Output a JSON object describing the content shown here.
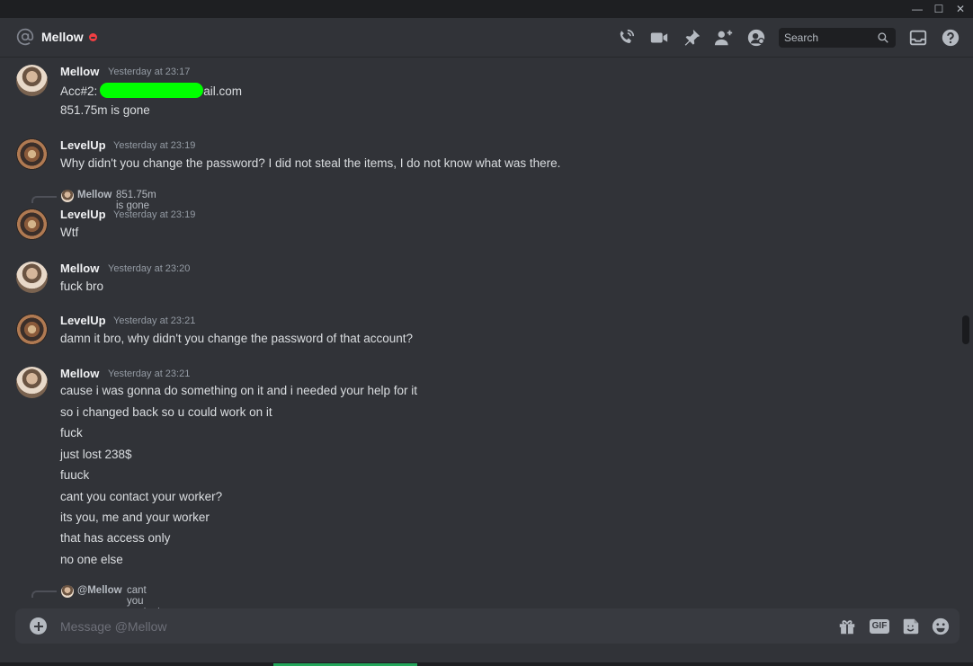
{
  "window": {
    "min_glyph": "—",
    "max_glyph": "☐",
    "close_glyph": "✕"
  },
  "header": {
    "channel_name": "Mellow",
    "search_placeholder": "Search"
  },
  "messages": [
    {
      "author": "Mellow",
      "timestamp": "Yesterday at 23:17",
      "lines": [
        "Acc#2:",
        "ail.com",
        "851.75m is gone"
      ]
    },
    {
      "author": "LevelUp",
      "timestamp": "Yesterday at 23:19",
      "lines": [
        "Why didn't you change the password? I did not steal the items, I do not know what was there."
      ]
    },
    {
      "reply_to": {
        "author": "Mellow",
        "text": "851.75m is gone"
      },
      "author": "LevelUp",
      "timestamp": "Yesterday at 23:19",
      "lines": [
        "Wtf"
      ]
    },
    {
      "author": "Mellow",
      "timestamp": "Yesterday at 23:20",
      "lines": [
        "fuck bro"
      ]
    },
    {
      "author": "LevelUp",
      "timestamp": "Yesterday at 23:21",
      "lines": [
        "damn it bro, why didn't you change the password of that account?"
      ]
    },
    {
      "author": "Mellow",
      "timestamp": "Yesterday at 23:21",
      "lines": [
        "cause i was gonna do something on it and i needed your help for it",
        "so i changed back so u could work on it",
        "fuck",
        "just lost 238$",
        "fuuck",
        "cant you contact your worker?",
        "its you, me and your worker",
        "that has access only",
        "no one else"
      ]
    },
    {
      "reply_to": {
        "author": "@Mellow",
        "text": "cant you contact your worker?"
      }
    }
  ],
  "composer": {
    "placeholder": "Message @Mellow",
    "gif_label": "GIF"
  },
  "colors": {
    "background": "#313338",
    "redaction": "#00ff00",
    "dnd": "#f23f43"
  },
  "icons": [
    "at-icon",
    "dnd-status-icon",
    "voice-call-icon",
    "video-call-icon",
    "pin-icon",
    "add-friend-icon",
    "user-profile-icon",
    "search-icon",
    "inbox-icon",
    "help-icon",
    "add-attachment-icon",
    "gift-icon",
    "gif-icon",
    "sticker-icon",
    "emoji-icon"
  ]
}
